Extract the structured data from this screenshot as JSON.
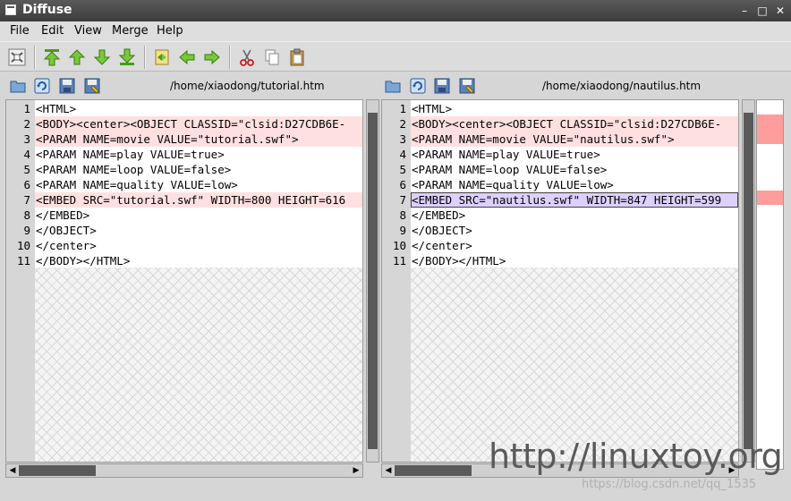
{
  "window": {
    "title": "Diffuse"
  },
  "menu": [
    "File",
    "Edit",
    "View",
    "Merge",
    "Help"
  ],
  "toolbar": {
    "icons": [
      "realign-icon",
      "first-change-icon",
      "previous-change-icon",
      "next-change-icon",
      "last-change-icon",
      "merge-from-left-right-icon",
      "copy-left-icon",
      "copy-right-icon",
      "cut-icon",
      "copy-icon",
      "paste-icon"
    ]
  },
  "left": {
    "path": "/home/xiaodong/tutorial.htm",
    "lines": [
      {
        "n": "1",
        "text": "<HTML>",
        "style": ""
      },
      {
        "n": "2",
        "text": "<BODY><center><OBJECT CLASSID=\"clsid:D27CDB6E-",
        "style": "pink"
      },
      {
        "n": "3",
        "text": "<PARAM NAME=movie VALUE=\"tutorial.swf\">",
        "style": "pink"
      },
      {
        "n": "4",
        "text": "<PARAM NAME=play VALUE=true>",
        "style": ""
      },
      {
        "n": "5",
        "text": "<PARAM NAME=loop VALUE=false>",
        "style": ""
      },
      {
        "n": "6",
        "text": "<PARAM NAME=quality VALUE=low>",
        "style": ""
      },
      {
        "n": "7",
        "text": "<EMBED SRC=\"tutorial.swf\" WIDTH=800 HEIGHT=616",
        "style": "pink"
      },
      {
        "n": "8",
        "text": "</EMBED>",
        "style": ""
      },
      {
        "n": "9",
        "text": "</OBJECT>",
        "style": ""
      },
      {
        "n": "10",
        "text": "</center>",
        "style": ""
      },
      {
        "n": "11",
        "text": "</BODY></HTML>",
        "style": ""
      }
    ]
  },
  "right": {
    "path": "/home/xiaodong/nautilus.htm",
    "lines": [
      {
        "n": "1",
        "text": "<HTML>",
        "style": ""
      },
      {
        "n": "2",
        "text": "<BODY><center><OBJECT CLASSID=\"clsid:D27CDB6E-",
        "style": "pink"
      },
      {
        "n": "3",
        "text": "<PARAM NAME=movie VALUE=\"nautilus.swf\">",
        "style": "pink"
      },
      {
        "n": "4",
        "text": "<PARAM NAME=play VALUE=true>",
        "style": ""
      },
      {
        "n": "5",
        "text": "<PARAM NAME=loop VALUE=false>",
        "style": ""
      },
      {
        "n": "6",
        "text": "<PARAM NAME=quality VALUE=low>",
        "style": ""
      },
      {
        "n": "7",
        "text": "<EMBED SRC=\"nautilus.swf\" WIDTH=847 HEIGHT=599",
        "style": "sel"
      },
      {
        "n": "8",
        "text": "</EMBED>",
        "style": ""
      },
      {
        "n": "9",
        "text": "</OBJECT>",
        "style": ""
      },
      {
        "n": "10",
        "text": "</center>",
        "style": ""
      },
      {
        "n": "11",
        "text": "</BODY></HTML>",
        "style": ""
      }
    ]
  },
  "watermark": {
    "main": "http://linuxtoy.org",
    "sub": "https://blog.csdn.net/qq_1535"
  },
  "colors": {
    "changed_line": "#ffe0e0",
    "changed_text": "#ffb9b9",
    "selected_line": "#ddd0ff",
    "overview_mark": "#ff9c9c"
  }
}
